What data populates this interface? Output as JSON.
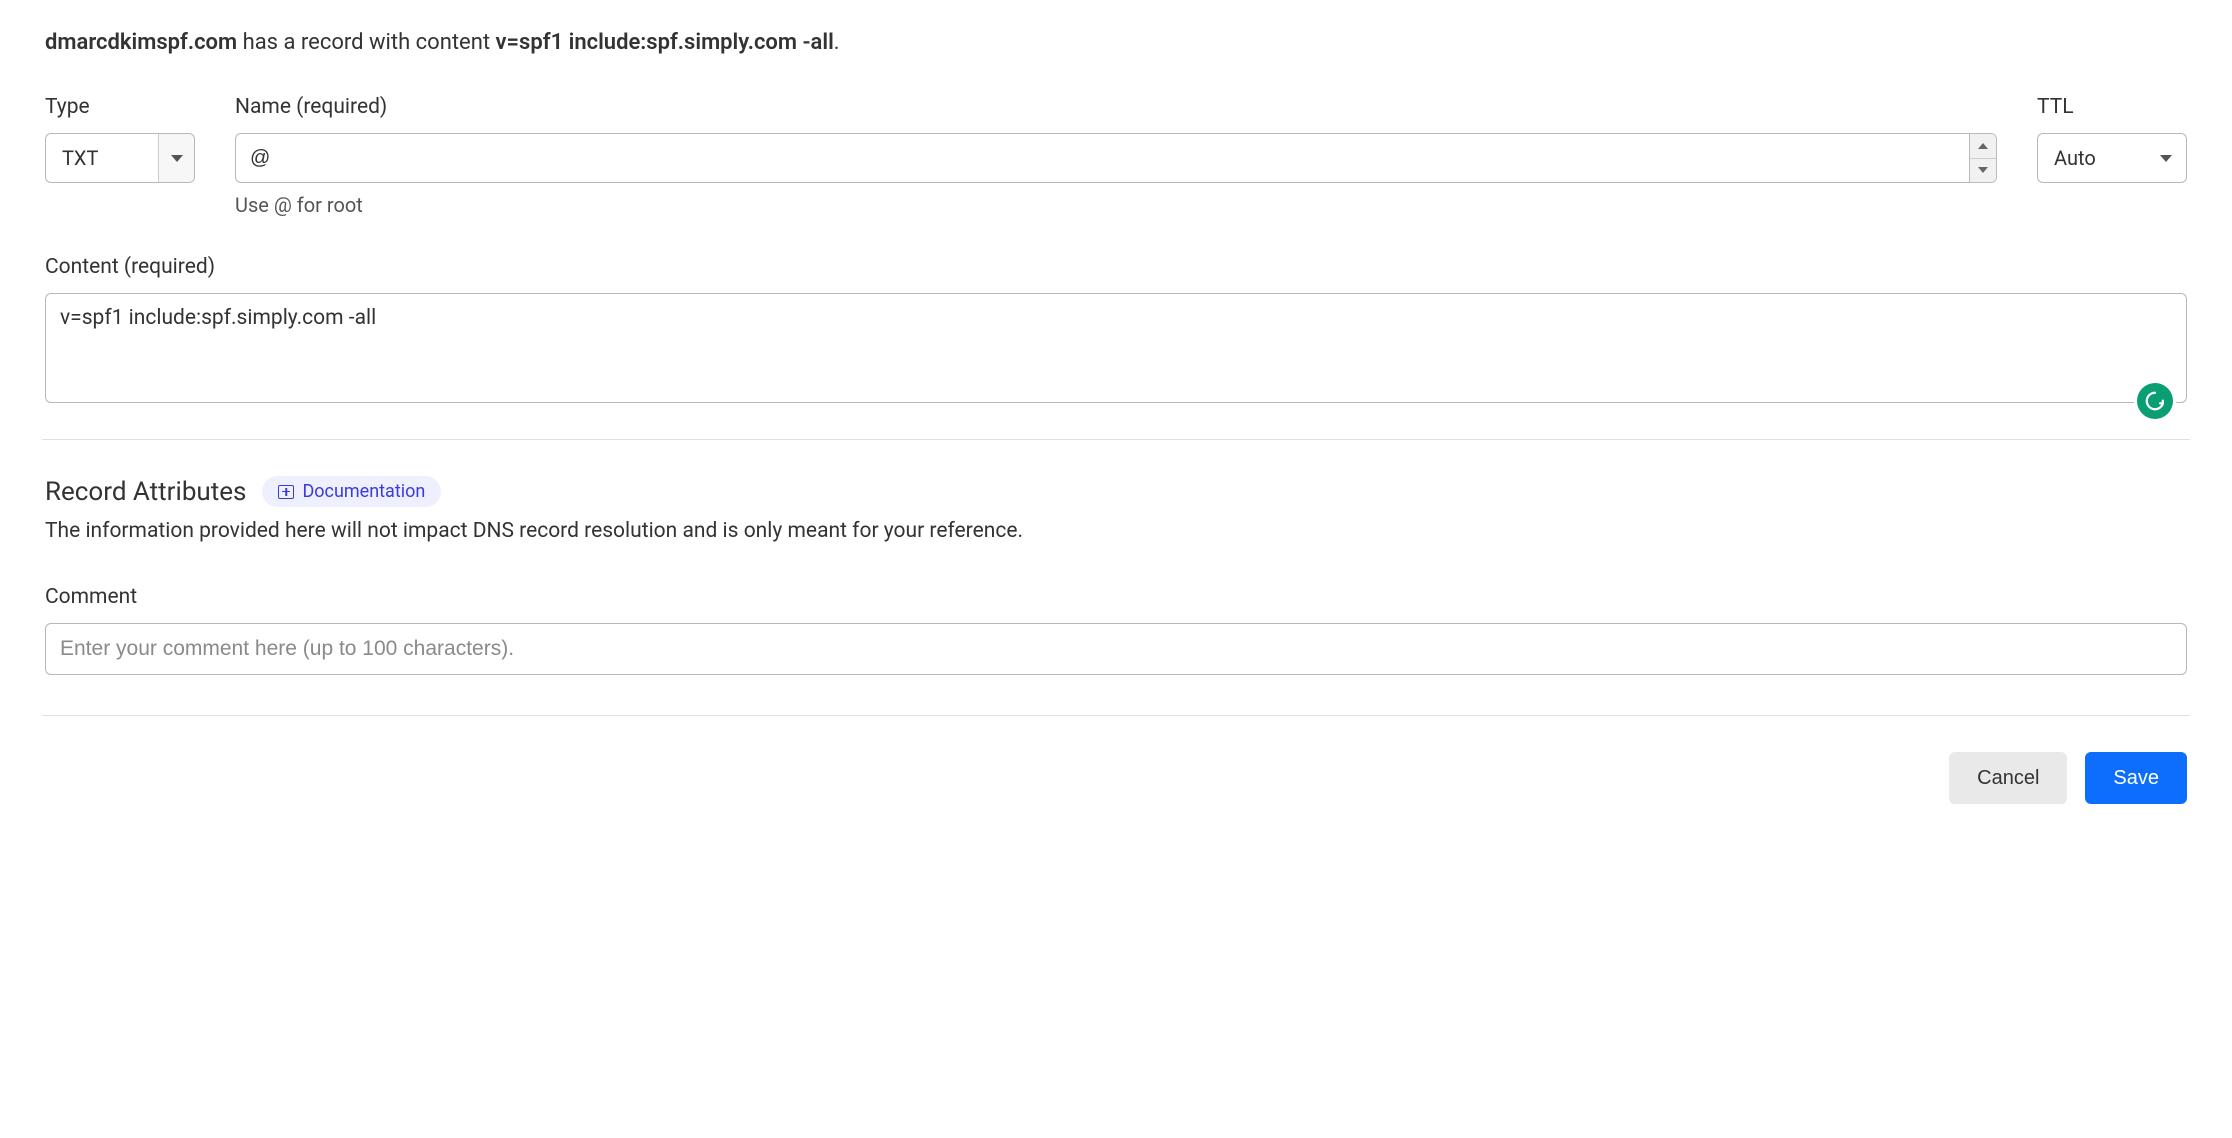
{
  "info": {
    "domain": "dmarcdkimspf.com",
    "middle_text": " has a record with content ",
    "content_value": "v=spf1 include:spf.simply.com -all",
    "suffix": "."
  },
  "form": {
    "type": {
      "label": "Type",
      "value": "TXT"
    },
    "name": {
      "label": "Name (required)",
      "value": "@",
      "help": "Use @ for root"
    },
    "ttl": {
      "label": "TTL",
      "value": "Auto"
    },
    "content": {
      "label": "Content (required)",
      "value": "v=spf1 include:spf.simply.com -all"
    }
  },
  "attributes": {
    "title": "Record Attributes",
    "doc_label": "Documentation",
    "description": "The information provided here will not impact DNS record resolution and is only meant for your reference.",
    "comment": {
      "label": "Comment",
      "placeholder": "Enter your comment here (up to 100 characters)."
    }
  },
  "actions": {
    "cancel": "Cancel",
    "save": "Save"
  }
}
